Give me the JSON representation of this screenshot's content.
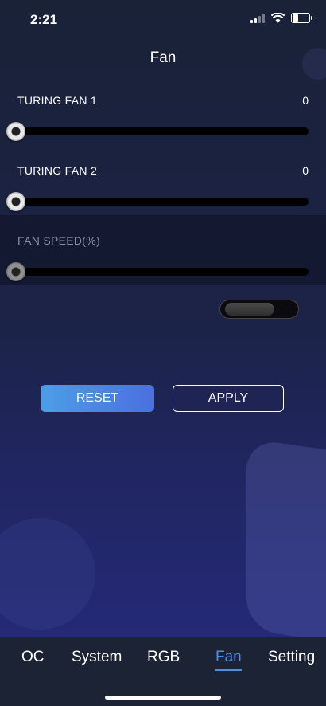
{
  "status_bar": {
    "time": "2:21"
  },
  "header": {
    "title": "Fan"
  },
  "fans": [
    {
      "label": "TURING FAN 1",
      "value": "0",
      "level": 0
    },
    {
      "label": "TURING FAN 2",
      "value": "0",
      "level": 0
    }
  ],
  "fan_speed": {
    "label": "FAN SPEED(%)",
    "level": 0
  },
  "toggle": {
    "state": "off"
  },
  "buttons": {
    "reset_label": "RESET",
    "apply_label": "APPLY"
  },
  "tabs": [
    {
      "label": "OC"
    },
    {
      "label": "System"
    },
    {
      "label": "RGB"
    },
    {
      "label": "Fan",
      "active": true
    },
    {
      "label": "Setting"
    }
  ],
  "colors": {
    "accent": "#4a8fe6",
    "background": "#1c2347"
  }
}
